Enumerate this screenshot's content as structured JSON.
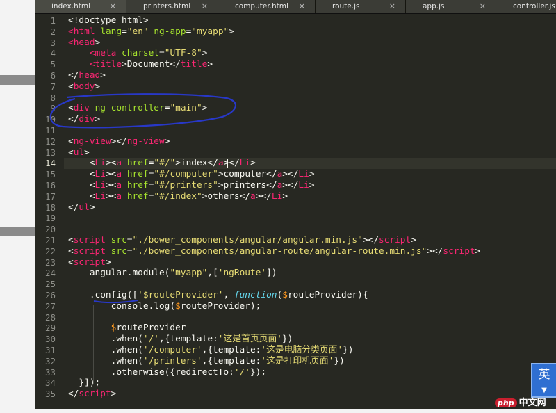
{
  "tabs": [
    {
      "label": "index.html",
      "active": true
    },
    {
      "label": "printers.html"
    },
    {
      "label": "computer.html"
    },
    {
      "label": "route.js"
    },
    {
      "label": "app.js"
    },
    {
      "label": "controller.js"
    }
  ],
  "tab_close_glyph": "×",
  "editor": {
    "current_line": 14,
    "lines": [
      [
        [
          "t-txt",
          "<!doctype html>"
        ]
      ],
      [
        [
          "t-tag",
          "<html"
        ],
        [
          "t-txt",
          " "
        ],
        [
          "t-attr",
          "lang"
        ],
        [
          "t-txt",
          "="
        ],
        [
          "t-str",
          "\"en\""
        ],
        [
          "t-txt",
          " "
        ],
        [
          "t-attr",
          "ng-app"
        ],
        [
          "t-txt",
          "="
        ],
        [
          "t-str",
          "\"myapp\""
        ],
        [
          "t-txt",
          ">"
        ]
      ],
      [
        [
          "t-tag",
          "<head"
        ],
        [
          "t-txt",
          ">"
        ]
      ],
      [
        [
          "t-txt",
          "    "
        ],
        [
          "t-tag",
          "<meta"
        ],
        [
          "t-txt",
          " "
        ],
        [
          "t-attr",
          "charset"
        ],
        [
          "t-txt",
          "="
        ],
        [
          "t-str",
          "\"UTF-8\""
        ],
        [
          "t-txt",
          ">"
        ]
      ],
      [
        [
          "t-txt",
          "    "
        ],
        [
          "t-tag",
          "<title"
        ],
        [
          "t-txt",
          ">Document</"
        ],
        [
          "t-tag",
          "title"
        ],
        [
          "t-txt",
          ">"
        ]
      ],
      [
        [
          "t-txt",
          "</"
        ],
        [
          "t-tag",
          "head"
        ],
        [
          "t-txt",
          ">"
        ]
      ],
      [
        [
          "t-txt",
          "<"
        ],
        [
          "t-tag",
          "body"
        ],
        [
          "t-txt",
          ">"
        ]
      ],
      [],
      [
        [
          "t-txt",
          "<"
        ],
        [
          "t-tag",
          "div"
        ],
        [
          "t-txt",
          " "
        ],
        [
          "t-attr",
          "ng-controller"
        ],
        [
          "t-txt",
          "="
        ],
        [
          "t-str",
          "\"main\""
        ],
        [
          "t-txt",
          ">"
        ]
      ],
      [
        [
          "t-txt",
          "</"
        ],
        [
          "t-tag",
          "div"
        ],
        [
          "t-txt",
          ">"
        ]
      ],
      [],
      [
        [
          "t-txt",
          "<"
        ],
        [
          "t-tag",
          "ng-view"
        ],
        [
          "t-txt",
          "></"
        ],
        [
          "t-tag",
          "ng-view"
        ],
        [
          "t-txt",
          ">"
        ]
      ],
      [
        [
          "t-txt",
          "<"
        ],
        [
          "t-tag",
          "ul"
        ],
        [
          "t-txt",
          ">"
        ]
      ],
      [
        [
          "t-txt",
          "    <"
        ],
        [
          "t-tag",
          "Li"
        ],
        [
          "t-txt",
          "><"
        ],
        [
          "t-tag",
          "a"
        ],
        [
          "t-txt",
          " "
        ],
        [
          "t-attr",
          "href"
        ],
        [
          "t-txt",
          "="
        ],
        [
          "t-str",
          "\"#/\""
        ],
        [
          "t-txt",
          ">index</"
        ],
        [
          "t-tag",
          "a"
        ],
        [
          "t-txt",
          "></"
        ],
        [
          "t-tag",
          "Li"
        ],
        [
          "t-txt",
          ">"
        ]
      ],
      [
        [
          "t-txt",
          "    <"
        ],
        [
          "t-tag",
          "Li"
        ],
        [
          "t-txt",
          "><"
        ],
        [
          "t-tag",
          "a"
        ],
        [
          "t-txt",
          " "
        ],
        [
          "t-attr",
          "href"
        ],
        [
          "t-txt",
          "="
        ],
        [
          "t-str",
          "\"#/computer\""
        ],
        [
          "t-txt",
          ">computer</"
        ],
        [
          "t-tag",
          "a"
        ],
        [
          "t-txt",
          "></"
        ],
        [
          "t-tag",
          "Li"
        ],
        [
          "t-txt",
          ">"
        ]
      ],
      [
        [
          "t-txt",
          "    <"
        ],
        [
          "t-tag",
          "Li"
        ],
        [
          "t-txt",
          "><"
        ],
        [
          "t-tag",
          "a"
        ],
        [
          "t-txt",
          " "
        ],
        [
          "t-attr",
          "href"
        ],
        [
          "t-txt",
          "="
        ],
        [
          "t-str",
          "\"#/printers\""
        ],
        [
          "t-txt",
          ">printers</"
        ],
        [
          "t-tag",
          "a"
        ],
        [
          "t-txt",
          "></"
        ],
        [
          "t-tag",
          "Li"
        ],
        [
          "t-txt",
          ">"
        ]
      ],
      [
        [
          "t-txt",
          "    <"
        ],
        [
          "t-tag",
          "Li"
        ],
        [
          "t-txt",
          "><"
        ],
        [
          "t-tag",
          "a"
        ],
        [
          "t-txt",
          " "
        ],
        [
          "t-attr",
          "href"
        ],
        [
          "t-txt",
          "="
        ],
        [
          "t-str",
          "\"#/index\""
        ],
        [
          "t-txt",
          ">others</"
        ],
        [
          "t-tag",
          "a"
        ],
        [
          "t-txt",
          "></"
        ],
        [
          "t-tag",
          "Li"
        ],
        [
          "t-txt",
          ">"
        ]
      ],
      [
        [
          "t-txt",
          "</"
        ],
        [
          "t-tag",
          "ul"
        ],
        [
          "t-txt",
          ">"
        ]
      ],
      [],
      [],
      [
        [
          "t-txt",
          "<"
        ],
        [
          "t-tag",
          "script"
        ],
        [
          "t-txt",
          " "
        ],
        [
          "t-attr",
          "src"
        ],
        [
          "t-txt",
          "="
        ],
        [
          "t-str",
          "\"./bower_components/angular/angular.min.js\""
        ],
        [
          "t-txt",
          "></"
        ],
        [
          "t-tag",
          "script"
        ],
        [
          "t-txt",
          ">"
        ]
      ],
      [
        [
          "t-txt",
          "<"
        ],
        [
          "t-tag",
          "script"
        ],
        [
          "t-txt",
          " "
        ],
        [
          "t-attr",
          "src"
        ],
        [
          "t-txt",
          "="
        ],
        [
          "t-str",
          "\"./bower_components/angular-route/angular-route.min.js\""
        ],
        [
          "t-txt",
          "></"
        ],
        [
          "t-tag",
          "script"
        ],
        [
          "t-txt",
          ">"
        ]
      ],
      [
        [
          "t-txt",
          "<"
        ],
        [
          "t-tag",
          "script"
        ],
        [
          "t-txt",
          ">"
        ]
      ],
      [
        [
          "t-txt",
          "    angular.module("
        ],
        [
          "t-str",
          "\"myapp\""
        ],
        [
          "t-txt",
          ",["
        ],
        [
          "t-str",
          "'ngRoute'"
        ],
        [
          "t-txt",
          "])"
        ]
      ],
      [],
      [
        [
          "t-txt",
          "    .config(["
        ],
        [
          "t-str",
          "'$routeProvider'"
        ],
        [
          "t-txt",
          ", "
        ],
        [
          "t-kw",
          "function"
        ],
        [
          "t-txt",
          "("
        ],
        [
          "t-var",
          "$"
        ],
        [
          "t-txt",
          "routeProvider){"
        ]
      ],
      [
        [
          "t-txt",
          "        console.log("
        ],
        [
          "t-var",
          "$"
        ],
        [
          "t-txt",
          "routeProvider);"
        ]
      ],
      [],
      [
        [
          "t-txt",
          "        "
        ],
        [
          "t-var",
          "$"
        ],
        [
          "t-txt",
          "routeProvider"
        ]
      ],
      [
        [
          "t-txt",
          "        .when("
        ],
        [
          "t-str",
          "'/'"
        ],
        [
          "t-txt",
          ",{template:"
        ],
        [
          "t-str",
          "'这是首页页面'"
        ],
        [
          "t-txt",
          "})"
        ]
      ],
      [
        [
          "t-txt",
          "        .when("
        ],
        [
          "t-str",
          "'/computer'"
        ],
        [
          "t-txt",
          ",{template:"
        ],
        [
          "t-str",
          "'这是电脑分类页面'"
        ],
        [
          "t-txt",
          "})"
        ]
      ],
      [
        [
          "t-txt",
          "        .when("
        ],
        [
          "t-str",
          "'/printers'"
        ],
        [
          "t-txt",
          ",{template:"
        ],
        [
          "t-str",
          "'这是打印机页面'"
        ],
        [
          "t-txt",
          "})"
        ]
      ],
      [
        [
          "t-txt",
          "        .otherwise({redirectTo:"
        ],
        [
          "t-str",
          "'/'"
        ],
        [
          "t-txt",
          "});"
        ]
      ],
      [
        [
          "t-txt",
          "  }]);"
        ]
      ],
      [
        [
          "t-txt",
          "</"
        ],
        [
          "t-tag",
          "script"
        ],
        [
          "t-txt",
          ">"
        ]
      ]
    ]
  },
  "ime": {
    "label": "英",
    "arrow": "▼"
  },
  "watermark": {
    "logo": "php",
    "text": "中文网"
  },
  "colors": {
    "annotation": "#2838c8"
  }
}
